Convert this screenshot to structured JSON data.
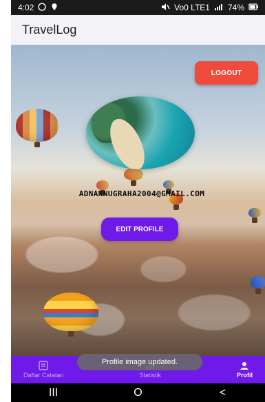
{
  "status": {
    "time": "4:02",
    "left_icons": [
      "whatsapp-icon",
      "location-icon"
    ],
    "right_text": "Vo0 LTE1",
    "battery": "74%"
  },
  "app": {
    "title": "TravelLog"
  },
  "profile": {
    "logout_label": "LOGOUT",
    "email": "ADNANNUGRAHA2004@GMAIL.COM",
    "edit_label": "EDIT PROFILE"
  },
  "bottom_nav": {
    "items": [
      {
        "label": "Daftar Catatan",
        "icon": "list-icon"
      },
      {
        "label": "Statistik",
        "icon": "chart-icon"
      },
      {
        "label": "Profil",
        "icon": "profile-icon"
      }
    ]
  },
  "toast": {
    "message": "Profile image updated."
  },
  "system_nav": {
    "recent_label": "III",
    "home_label": "O",
    "back_label": "<"
  }
}
